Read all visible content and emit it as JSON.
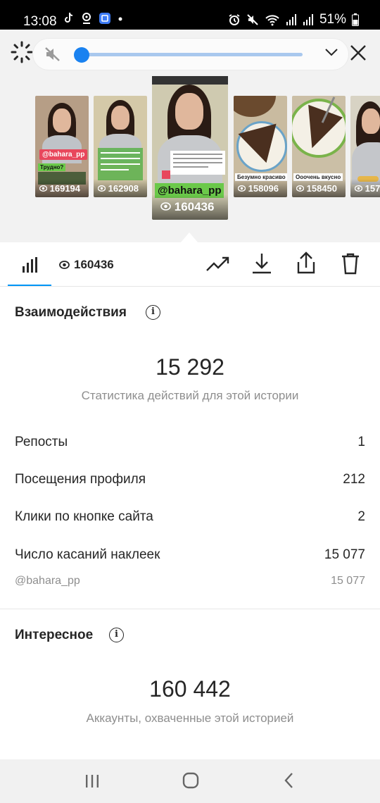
{
  "status_bar": {
    "time": "13:08",
    "battery": "51%",
    "left_icons": [
      "tiktok-icon",
      "location-icon",
      "app-icon",
      "dot-icon"
    ],
    "right_icons": [
      "alarm-icon",
      "mute-icon",
      "wifi-icon",
      "signal-icon",
      "signal-icon",
      "battery-icon"
    ]
  },
  "player": {
    "progress": 0.03
  },
  "stories": [
    {
      "views": "169194",
      "tag": "@bahara_pp",
      "caption": "Трудно?",
      "style": "portrait",
      "accent": "#e8475c"
    },
    {
      "views": "162908",
      "caption": "",
      "style": "portrait-green",
      "accent": "#5bb04b"
    },
    {
      "views": "160436",
      "tag": "@bahara_pp",
      "style": "portrait-big",
      "selected": true
    },
    {
      "views": "158096",
      "caption": "Безумно красиво",
      "style": "pie"
    },
    {
      "views": "158450",
      "caption": "Ооочень вкусно",
      "style": "pie"
    },
    {
      "views": "157",
      "style": "portrait-cut"
    }
  ],
  "action_bar": {
    "views": "160436",
    "icons": [
      "bar-chart-icon",
      "eye-icon",
      "trending-icon",
      "download-icon",
      "share-icon",
      "trash-icon"
    ]
  },
  "interactions": {
    "title": "Взаимодействия",
    "total": "15 292",
    "subtitle": "Статистика действий для этой истории",
    "rows": [
      {
        "label": "Репосты",
        "value": "1"
      },
      {
        "label": "Посещения профиля",
        "value": "212"
      },
      {
        "label": "Клики по кнопке сайта",
        "value": "2"
      },
      {
        "label": "Число касаний наклеек",
        "value": "15 077"
      }
    ],
    "sub_row": {
      "label": "@bahara_pp",
      "value": "15 077"
    }
  },
  "discovery": {
    "title": "Интересное",
    "total": "160 442",
    "subtitle": "Аккаунты, охваченные этой историей"
  },
  "colors": {
    "accent_blue": "#0095f6",
    "slider_blue": "#1a82f0",
    "tag_green": "#6bc94a",
    "tag_pink": "#e8475c"
  }
}
